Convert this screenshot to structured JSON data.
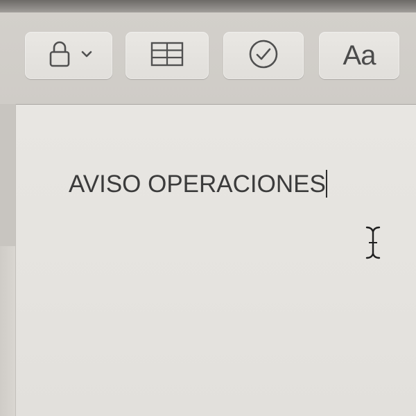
{
  "toolbar": {
    "lock_button": {
      "icon": "lock-icon",
      "dropdown_icon": "chevron-down-icon"
    },
    "table_button": {
      "icon": "table-icon"
    },
    "checklist_button": {
      "icon": "checkmark-circle-icon"
    },
    "format_button": {
      "label": "Aa"
    }
  },
  "editor": {
    "text": "AVISO OPERACIONES",
    "cursor_icon": "text-cursor-icon"
  },
  "colors": {
    "toolbar_bg": "#cfccc7",
    "button_bg": "#e5e3df",
    "editor_bg": "#e6e4e0",
    "text": "#3b3b3b"
  }
}
